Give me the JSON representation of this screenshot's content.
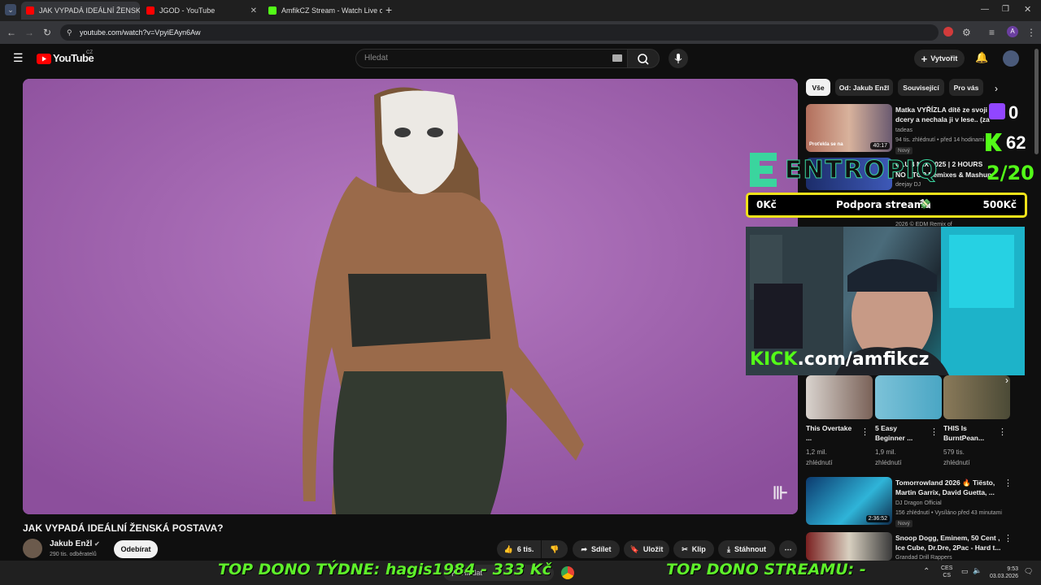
{
  "browser": {
    "tabs": [
      {
        "label": "JAK VYPADÁ IDEÁLNÍ ŽENSK",
        "favicon_color": "#ff0000"
      },
      {
        "label": "JGOD - YouTube",
        "favicon_color": "#ff0000"
      },
      {
        "label": "AmfikCZ Stream - Watch Live o",
        "favicon_color": "#53fc18"
      }
    ],
    "url": "youtube.com/watch?v=VpyiEAyn6Aw"
  },
  "youtube": {
    "logo": "YouTube",
    "country": "CZ",
    "search_placeholder": "Hledat",
    "create_label": "Vytvořit"
  },
  "video": {
    "title": "JAK VYPADÁ IDEÁLNÍ ŽENSKÁ POSTAVA?",
    "channel": "Jakub Enžl",
    "subscribers": "290 tis. odběratelů",
    "subscribe_label": "Odebírat",
    "likes": "6 tis.",
    "share_label": "Sdílet",
    "save_label": "Uložit",
    "clip_label": "Klip",
    "download_label": "Stáhnout"
  },
  "sidebar": {
    "chips": [
      "Vše",
      "Od: Jakub Enžl",
      "Související",
      "Pro vás"
    ],
    "items": [
      {
        "title1": "Matka VYŘÍZLA dítě ze svoji",
        "title2": "dcery a nechala ji v lese.. (za",
        "channel": "tadeas",
        "meta": "94 tis. zhlédnutí • před 14 hodinami",
        "badge": "Nový",
        "duration": "40:17",
        "thumb_caption": "Proťekla se na"
      },
      {
        "title1": "CLUB MIX 2025 | 2 HOURS",
        "title2": "NO STOP Remixes & Mashup",
        "channel": "deejay DJ"
      },
      {
        "title1": "2026 © EDM Remix of"
      },
      {
        "title": "This Overtake ...",
        "meta1": "1,2 mil.",
        "meta2": "zhlédnutí"
      },
      {
        "title": "5 Easy Beginner ...",
        "meta1": "1,9 mil.",
        "meta2": "zhlédnutí"
      },
      {
        "title": "THIS Is BurntPean...",
        "meta1": "579 tis.",
        "meta2": "zhlédnutí"
      },
      {
        "title1": "Tomorrowland 2026 🔥 Tiësto,",
        "title2": "Martin Garrix, David Guetta, ...",
        "channel": "DJ Dragon Official",
        "meta": "156 zhlédnutí • Vysíláno před 43 minutami",
        "badge": "Nový",
        "duration": "2:36:52"
      },
      {
        "title1": "Snoop Dogg, Eminem, 50 Cent ,",
        "title2": "Ice Cube, Dr.Dre, 2Pac - Hard t...",
        "channel": "Grandad Drill Rappers"
      }
    ]
  },
  "overlay": {
    "brand": "ENTROPIQ",
    "twitch_count": "0",
    "kick_count": "62",
    "sub_goal": "2/20",
    "goal_start": "0Kč",
    "goal_label": "Podpora streamu",
    "goal_end": "500Kč",
    "kick_domain": "KICK",
    "kick_path": ".com/amfikcz",
    "ticker_left": "TOP DONO TÝDNE:  hagis1984 - 333 Kč",
    "ticker_right": "TOP DONO STREAMU: -"
  },
  "taskbar": {
    "search": "Hledat",
    "lang1": "CES",
    "lang2": "CS",
    "time": "9:53",
    "date": "03.03.2026"
  }
}
